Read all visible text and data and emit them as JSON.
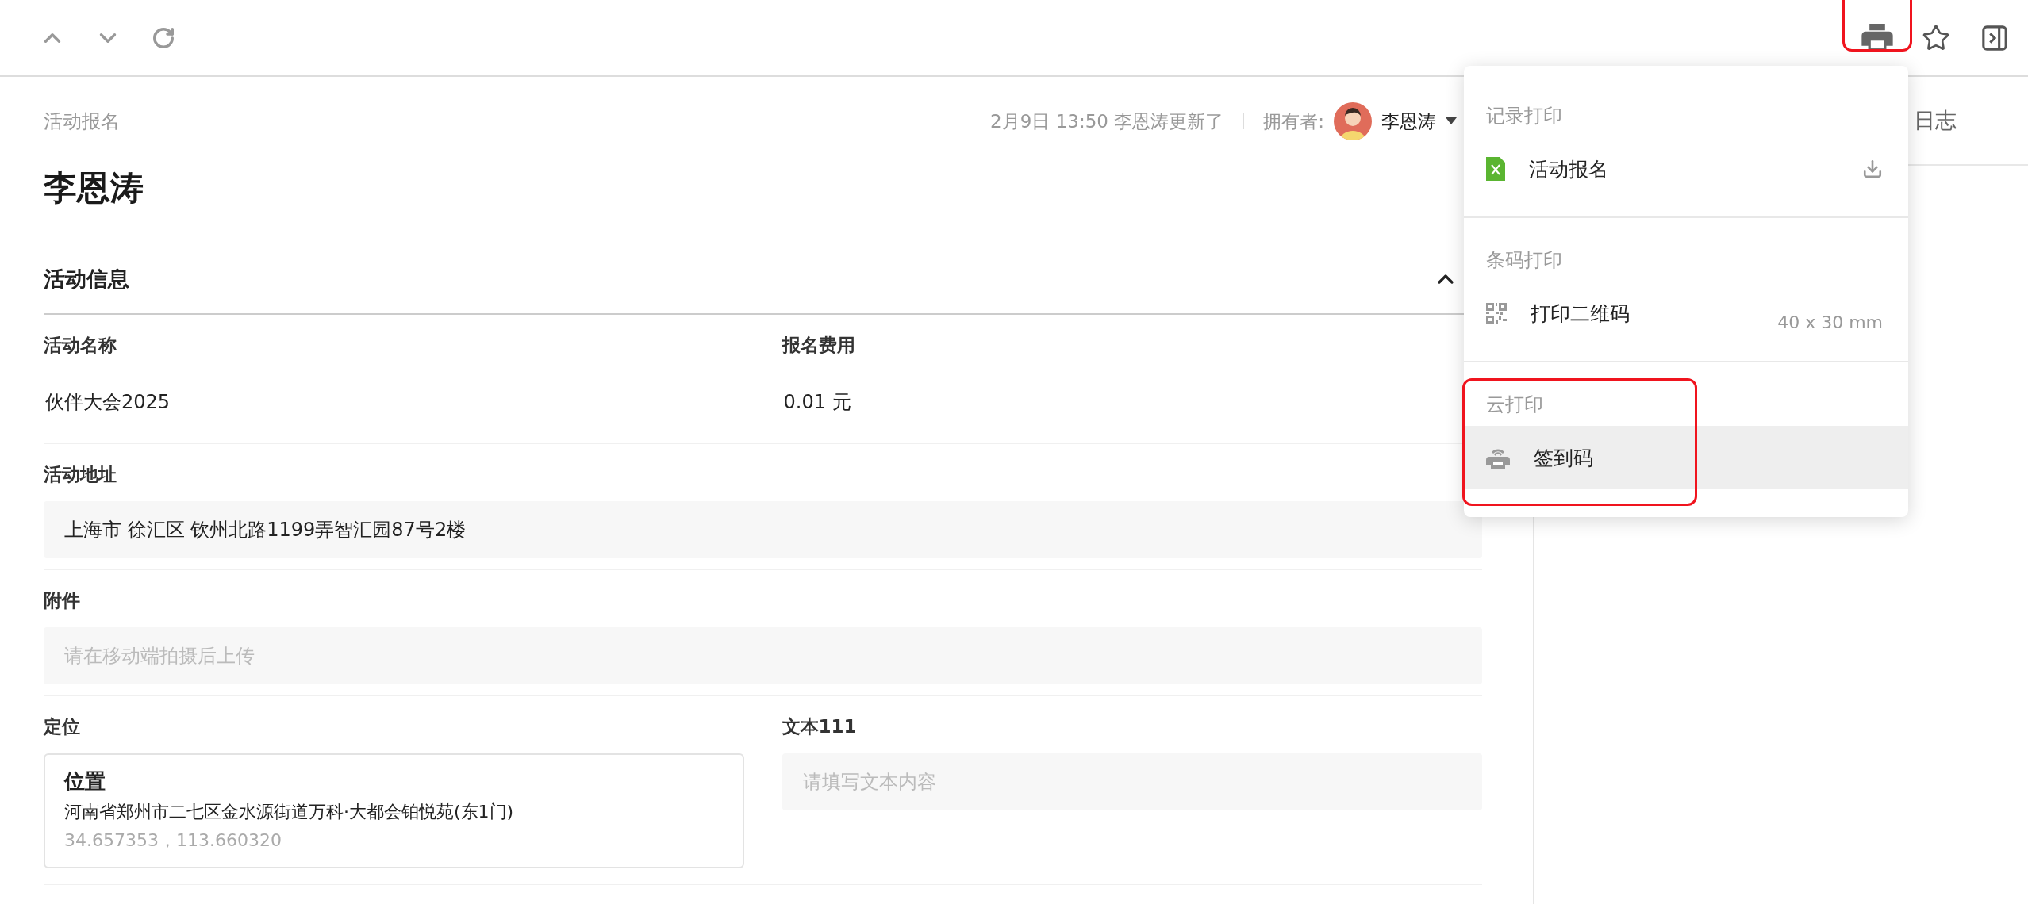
{
  "print_button": {
    "highlighted": true
  },
  "breadcrumb": "活动报名",
  "updated": "2月9日 13:50 李恩涛更新了",
  "owner": {
    "label": "拥有者:",
    "name": "李恩涛"
  },
  "title": "李恩涛",
  "section": {
    "title": "活动信息",
    "expanded": true
  },
  "rows": [
    {
      "fields": [
        {
          "kind": "text",
          "label": "活动名称",
          "value": "伙伴大会2025"
        },
        {
          "kind": "text",
          "label": "报名费用",
          "value": "0.01 元"
        }
      ]
    },
    {
      "fields": [
        {
          "kind": "box",
          "label": "活动地址",
          "value": "上海市 徐汇区 钦州北路1199弄智汇园87号2楼"
        }
      ]
    },
    {
      "fields": [
        {
          "kind": "box",
          "label": "附件",
          "placeholder": "请在移动端拍摄后上传"
        }
      ]
    },
    {
      "fields": [
        {
          "kind": "location",
          "label": "定位",
          "location": {
            "title": "位置",
            "address": "河南省郑州市二七区金水源街道万科·大都会铂悦苑(东1门)",
            "coords": "34.657353，113.660320"
          }
        },
        {
          "kind": "box",
          "label": "文本111",
          "placeholder": "请填写文本内容"
        }
      ]
    }
  ],
  "side_panel": {
    "tab": "日志"
  },
  "print_menu": {
    "groups": [
      {
        "title": "记录打印",
        "highlighted": false,
        "items": [
          {
            "kind": "excel",
            "label": "活动报名",
            "downloadable": true,
            "selected": false
          }
        ]
      },
      {
        "title": "条码打印",
        "highlighted": false,
        "items": [
          {
            "kind": "qrcode",
            "label": "打印二维码",
            "note": "40 x 30 mm",
            "selected": false
          }
        ]
      },
      {
        "title": "云打印",
        "highlighted": true,
        "items": [
          {
            "kind": "cloud",
            "label": "签到码",
            "selected": true
          }
        ]
      }
    ]
  }
}
